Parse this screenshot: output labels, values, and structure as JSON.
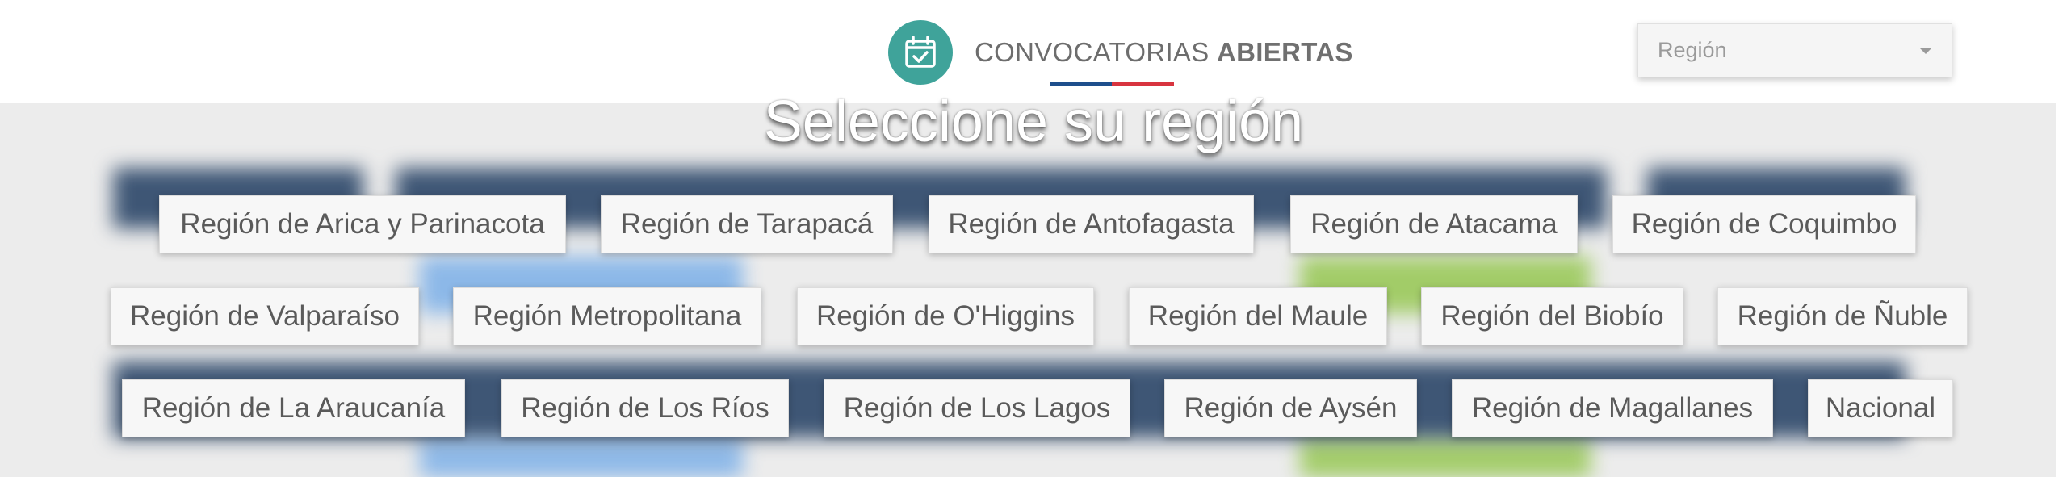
{
  "header": {
    "brand_regular": "CONVOCATORIAS ",
    "brand_bold": "ABIERTAS",
    "logo_icon": "calendar-check-icon",
    "colors": {
      "teal": "#3fa39a",
      "flag_blue": "#1e4f8c",
      "flag_red": "#d8343f"
    }
  },
  "region_select": {
    "placeholder": "Región"
  },
  "modal": {
    "title": "Seleccione su región",
    "regions": [
      "Región de Arica y Parinacota",
      "Región de Tarapacá",
      "Región de Antofagasta",
      "Región de Atacama",
      "Región de Coquimbo",
      "Región de Valparaíso",
      "Región Metropolitana",
      "Región de O'Higgins",
      "Región del Maule",
      "Región del Biobío",
      "Región de Ñuble",
      "Región de La Araucanía",
      "Región de Los Ríos",
      "Región de Los Lagos",
      "Región de Aysén",
      "Región de Magallanes",
      "Nacional"
    ]
  }
}
